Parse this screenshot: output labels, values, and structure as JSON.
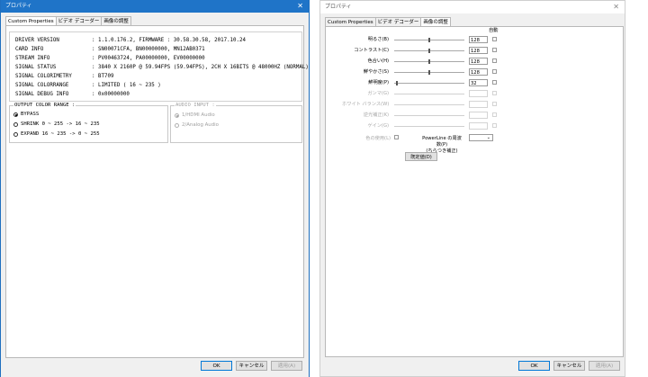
{
  "left_window": {
    "title": "プロパティ",
    "close": "✕",
    "tabs": [
      "Custom Properties",
      "ビデオ デコーダー",
      "画像の調整"
    ],
    "info_rows": [
      {
        "key": "DRIVER VERSION",
        "value": ": 1.1.0.176.2, FIRMWARE : 30.58.30.58, 2017.10.24"
      },
      {
        "key": "CARD INFO",
        "value": ": SN00071CFA, BN00000000, MN12AB0371"
      },
      {
        "key": "STREAM INFO",
        "value": ": PV00463724, PA00000000, EV00000000"
      },
      {
        "key": "SIGNAL STATUS",
        "value": ": 3840 X 2160P @ 59.94FPS (59.94FPS), 2CH X 16BITS @ 48000HZ (NORMAL)"
      },
      {
        "key": "SIGNAL COLORIMETRY",
        "value": ": BT709"
      },
      {
        "key": "SIGNAL COLORRANGE",
        "value": ": LIMITED ( 16 ~ 235 )"
      },
      {
        "key": "SIGNAL DEBUG INFO",
        "value": ": 0x00000000"
      }
    ],
    "color_range": {
      "title": "OUTPUT COLOR RANGE :",
      "options": [
        {
          "label": "BYPASS",
          "checked": true
        },
        {
          "label": "SHRINK  0 ~ 255 -> 16 ~ 235",
          "checked": false
        },
        {
          "label": "EXPAND 16 ~ 235 ->  0 ~ 255",
          "checked": false
        }
      ]
    },
    "audio_input": {
      "title": "AUDIO INPUT :",
      "options": [
        {
          "label": "1/HDMI Audio",
          "checked": true
        },
        {
          "label": "2/Analog Audio",
          "checked": false
        }
      ]
    },
    "buttons": {
      "ok": "OK",
      "cancel": "キャンセル",
      "apply": "適用(A)"
    }
  },
  "right_window": {
    "title": "プロパティ",
    "close": "✕",
    "tabs": [
      "Custom Properties",
      "ビデオ デコーダー",
      "画像の調整"
    ],
    "auto_label": "自動",
    "rows": [
      {
        "label": "明るさ(B)",
        "value": "128",
        "enabled": true,
        "level": 0.5
      },
      {
        "label": "コントラスト(C)",
        "value": "128",
        "enabled": true,
        "level": 0.5
      },
      {
        "label": "色合い(H)",
        "value": "128",
        "enabled": true,
        "level": 0.5
      },
      {
        "label": "鮮やかさ(S)",
        "value": "128",
        "enabled": true,
        "level": 0.5
      },
      {
        "label": "鮮明度(P)",
        "value": "32",
        "enabled": true,
        "level": 0.04
      },
      {
        "label": "ガンマ(G)",
        "value": "",
        "enabled": false
      },
      {
        "label": "ホワイト バランス(W)",
        "value": "",
        "enabled": false
      },
      {
        "label": "逆光補正(K)",
        "value": "",
        "enabled": false
      },
      {
        "label": "ゲイン(G)",
        "value": "",
        "enabled": false
      }
    ],
    "color_enable": "色の使用(L)",
    "powerline_line1": "PowerLine の周波数(P)",
    "powerline_line2": "(ちらつき補正)",
    "default_button": "既定値(D)",
    "buttons": {
      "ok": "OK",
      "cancel": "キャンセル",
      "apply": "適用(A)"
    }
  }
}
